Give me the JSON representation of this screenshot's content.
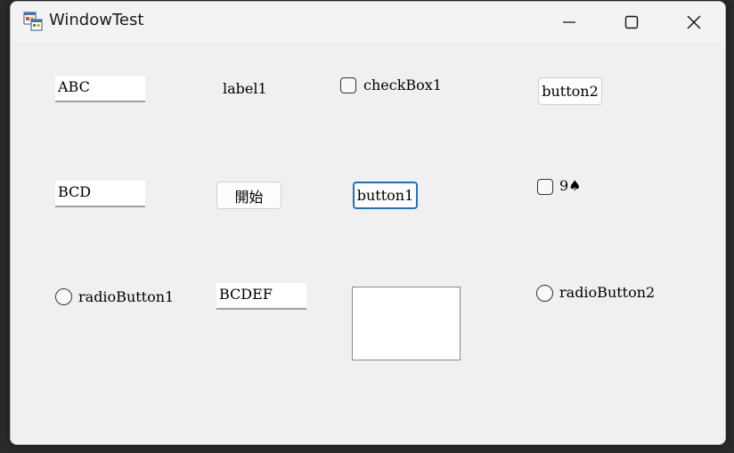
{
  "window": {
    "title": "WindowTest",
    "app_icon": "windows-form-app-icon"
  },
  "caption_buttons": {
    "minimize": "minimize-icon",
    "maximize": "maximize-icon",
    "close": "close-icon"
  },
  "row1": {
    "textbox_value": "ABC",
    "label": "label1",
    "checkbox_label": "checkBox1",
    "button_label": "button2"
  },
  "row2": {
    "textbox_value": "BCD",
    "start_button_label": "開始",
    "button_label": "button1",
    "checkbox_label": "9♠"
  },
  "row3": {
    "radio1_label": "radioButton1",
    "textbox_value": "BCDEF",
    "radio2_label": "radioButton2"
  },
  "colors": {
    "focus_border": "#1a73c8",
    "window_bg": "#f0f0f0"
  }
}
